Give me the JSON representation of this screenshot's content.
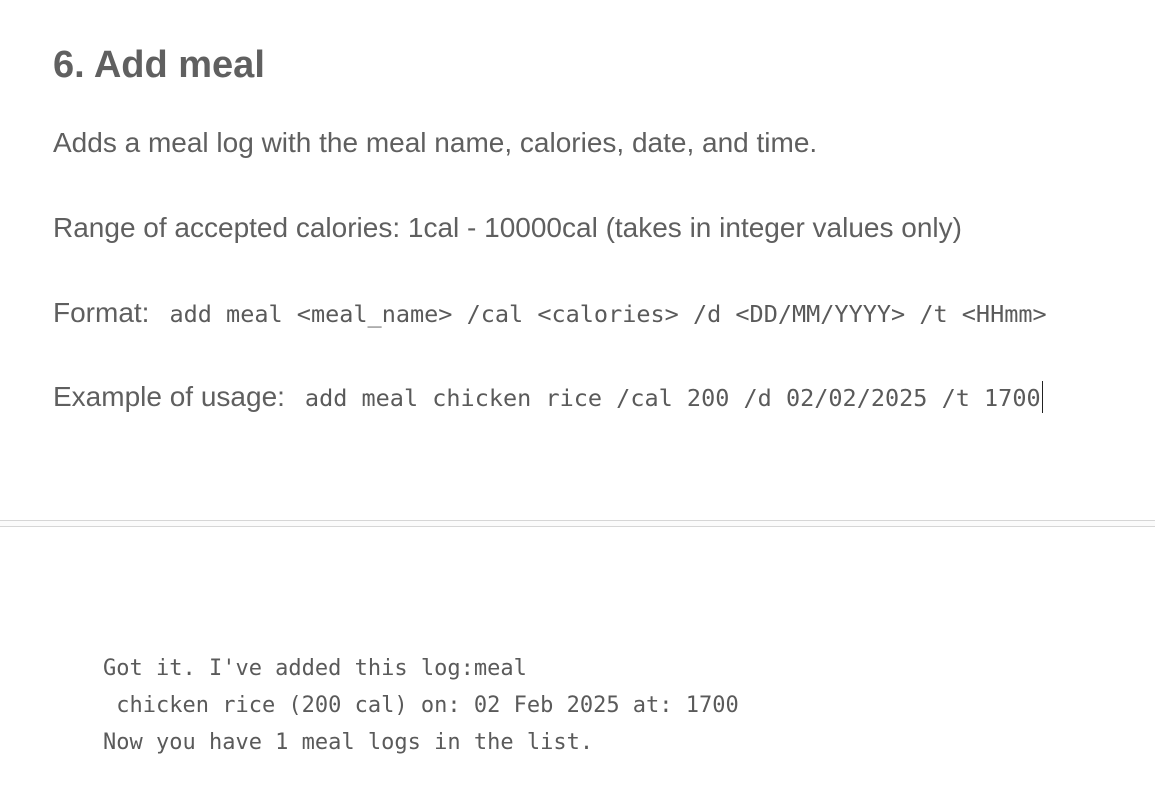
{
  "section": {
    "title": "6. Add meal",
    "description": "Adds a meal log with the meal name, calories, date, and time.",
    "range_text": "Range of accepted calories: 1cal - 10000cal (takes in integer values only)",
    "format_label": "Format:",
    "format_code": "add meal <meal_name> /cal <calories> /d <DD/MM/YYYY> /t <HHmm>",
    "example_label": "Example of usage:",
    "example_code": "add meal chicken rice /cal 200 /d 02/02/2025 /t 1700"
  },
  "output": {
    "lines": [
      "Got it. I've added this log:meal",
      " chicken rice (200 cal) on: 02 Feb 2025 at: 1700",
      "Now you have 1 meal logs in the list."
    ]
  }
}
